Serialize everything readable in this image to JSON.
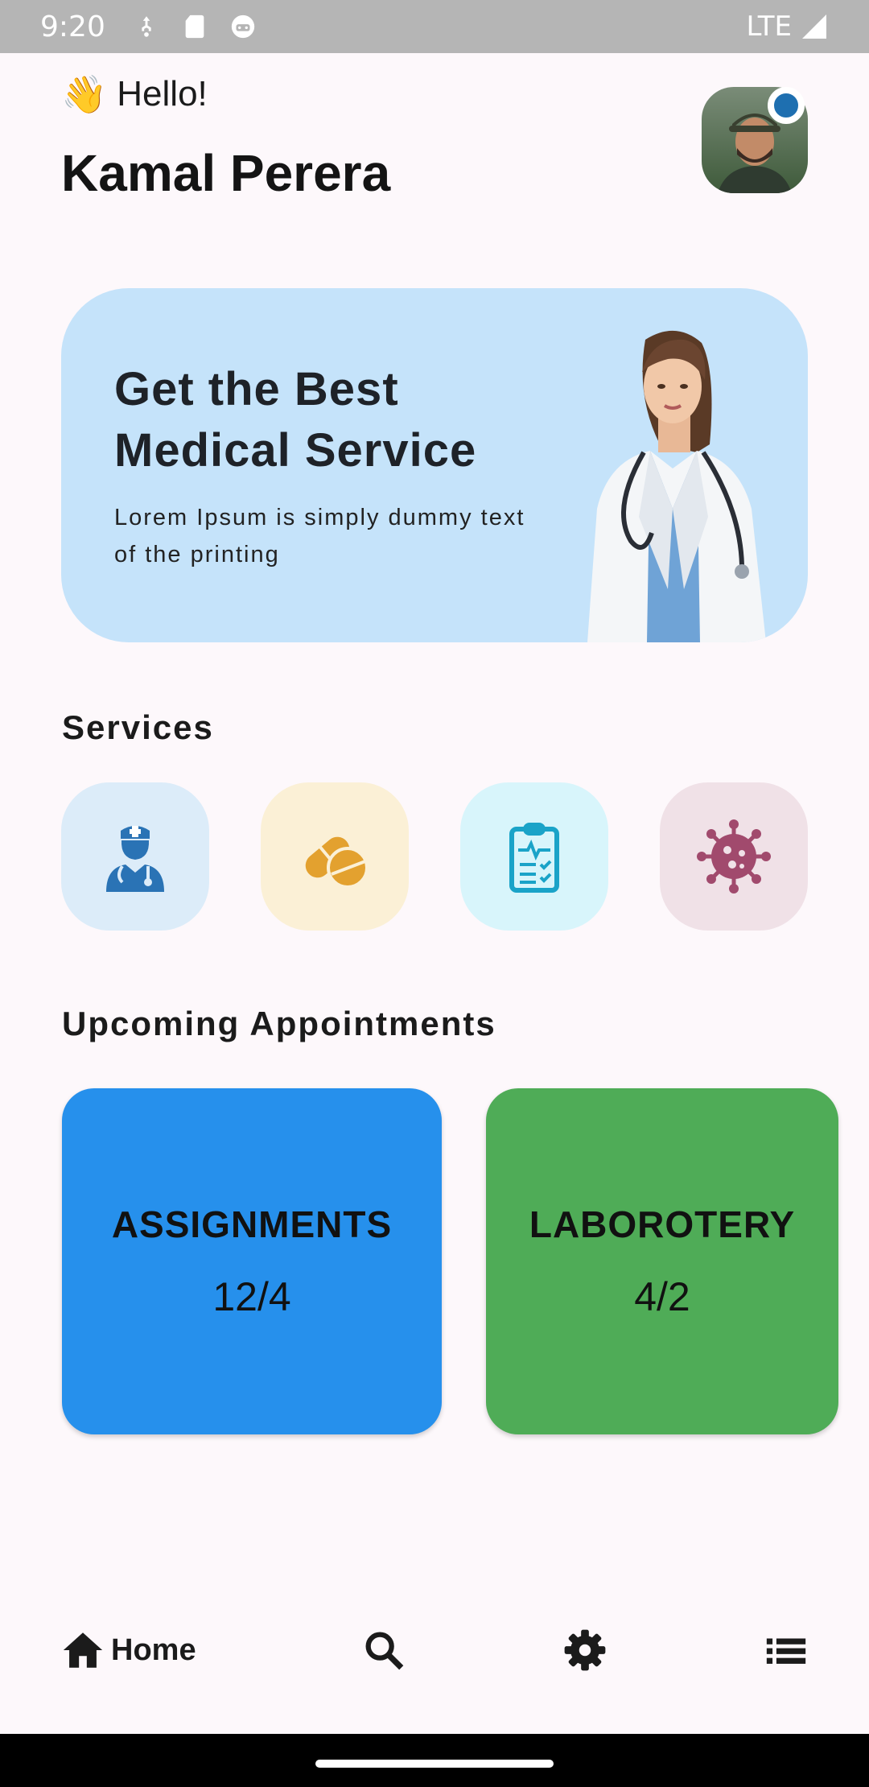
{
  "status_bar": {
    "time": "9:20",
    "network": "LTE",
    "icons": [
      "usb-debug-icon",
      "sd-card-icon",
      "android-icon",
      "signal-icon"
    ]
  },
  "header": {
    "greeting_emoji": "👋",
    "greeting": "Hello!",
    "user_name": "Kamal Perera",
    "avatar_icon": "user-avatar",
    "online_color": "#1e6fb0"
  },
  "hero": {
    "title": "Get the Best Medical Service",
    "subtitle": "Lorem Ipsum is simply dummy text of the printing",
    "background": "#c5e3fa"
  },
  "services": {
    "title": "Services",
    "items": [
      {
        "icon": "doctor-icon",
        "bg": "#dcecf9",
        "fg": "#2a73b5"
      },
      {
        "icon": "pills-icon",
        "bg": "#fbf0d6",
        "fg": "#e3a12f"
      },
      {
        "icon": "clipboard-icon",
        "bg": "#d8f5fb",
        "fg": "#1aa3c8"
      },
      {
        "icon": "virus-icon",
        "bg": "#f0e1e7",
        "fg": "#a14a6d"
      }
    ]
  },
  "appointments": {
    "title": "Upcoming Appointments",
    "cards": [
      {
        "label": "ASSIGNMENTS",
        "value": "12/4",
        "color": "#2690ec"
      },
      {
        "label": "LABOROTERY",
        "value": "4/2",
        "color": "#4fac57"
      }
    ]
  },
  "bottom_nav": {
    "home_label": "Home",
    "items": [
      "home-icon",
      "search-icon",
      "settings-icon",
      "list-icon"
    ]
  }
}
